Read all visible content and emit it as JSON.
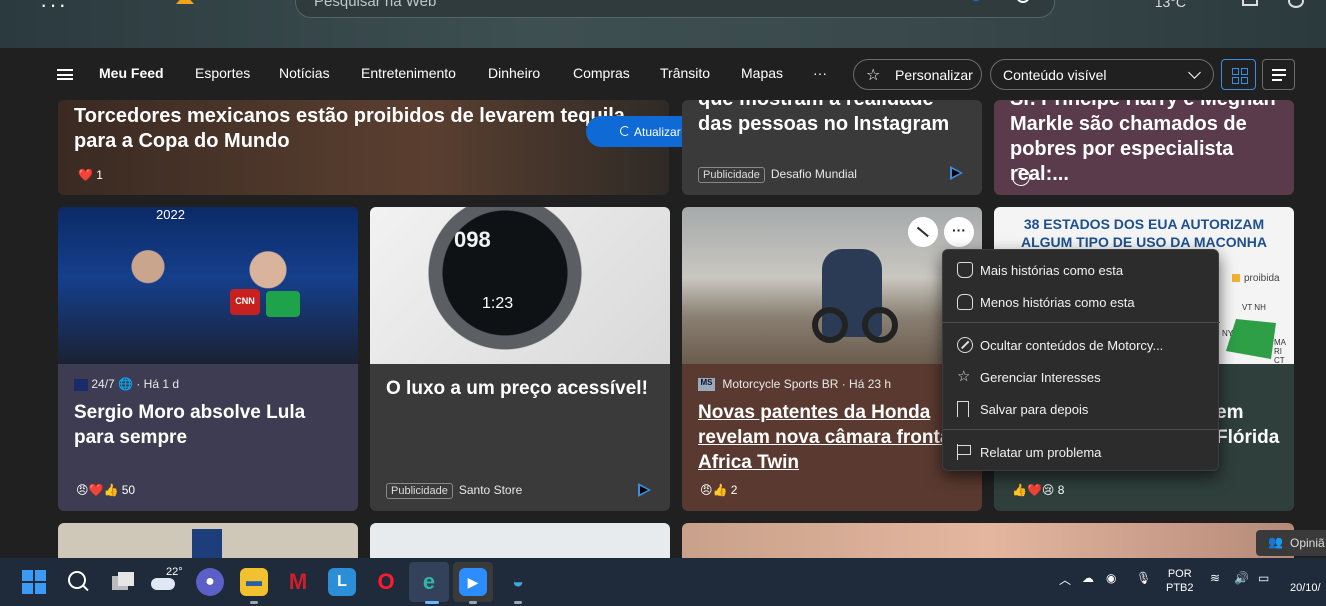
{
  "search": {
    "placeholder": "Pesquisar na Web"
  },
  "top": {
    "left_label": "···",
    "right_label": "13°C"
  },
  "nav": {
    "items": [
      "Meu Feed",
      "Esportes",
      "Notícias",
      "Entretenimento",
      "Dinheiro",
      "Compras",
      "Trânsito",
      "Mapas",
      "···"
    ],
    "personalize": "Personalizar",
    "content_select": "Conteúdo visível"
  },
  "refresh": {
    "label": "Atualizar histórias"
  },
  "cards": {
    "c1": {
      "title": "Torcedores mexicanos estão proibidos de levarem tequila para a Copa do Mundo",
      "reactions": "1"
    },
    "c2": {
      "title": "que mostram a realidade das pessoas no Instagram",
      "ad_label": "Publicidade",
      "source": "Desafio Mundial"
    },
    "c3": {
      "title": "Sr. Príncipe Harry e Meghan Markle são chamados de pobres por especialista real:..."
    },
    "c4": {
      "year": "2022",
      "mic": "CNN",
      "source": "24/7",
      "time": "· Há 1 d",
      "title": "Sergio Moro absolve Lula para sempre",
      "reactions": "50"
    },
    "c5": {
      "watch_top": "098",
      "watch_bottom": "1:23",
      "title": "O luxo a um preço acessível!",
      "ad_label": "Publicidade",
      "source": "Santo Store"
    },
    "c6": {
      "logo": "MS",
      "source": "Motorcycle Sports BR · Há 23 h",
      "title": "Novas patentes da Honda revelam nova câmara frontal na Africa Twin",
      "reactions": "2"
    },
    "c7": {
      "headline": "38 ESTADOS DOS EUA AUTORIZAM ALGUM TIPO DE USO DA MACONHA",
      "legend": "proibida",
      "states": [
        "VT NH",
        "NY",
        "MA",
        "RI",
        "CT"
      ],
      "title_tail": "em Flórida",
      "reactions": "8"
    }
  },
  "menu": {
    "items": [
      "Mais histórias como esta",
      "Menos histórias como esta",
      "Ocultar conteúdos de Motorcy...",
      "Gerenciar Interesses",
      "Salvar para depois",
      "Relatar um problema"
    ]
  },
  "opiniao": "Opiniã",
  "taskbar": {
    "temp": "22°",
    "lang": [
      "POR",
      "PTB2"
    ],
    "date": "20/10/"
  },
  "colors": {
    "accent": "#0f6ad6",
    "card_dark": "#3a3a3a"
  }
}
